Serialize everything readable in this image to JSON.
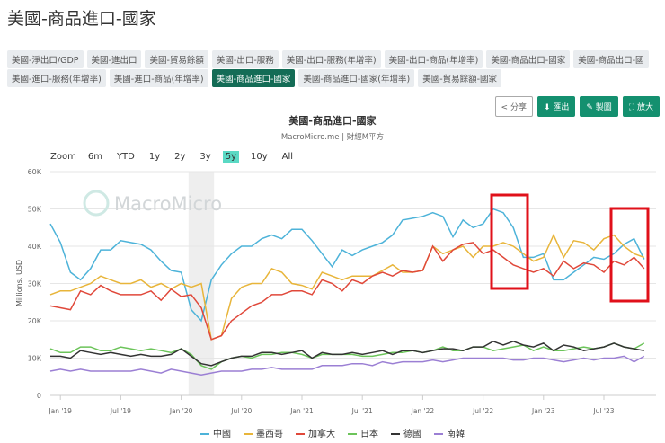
{
  "page_title": "美國-商品進口-國家",
  "tags_row1": [
    "美國-淨出口/GDP",
    "美國-進出口",
    "美國-貿易餘額",
    "美國-出口-服務",
    "美國-出口-服務(年增率)",
    "美國-出口-商品(年增率)",
    "美國-商品出口-國家",
    "美國-商品出口-國"
  ],
  "tags_row2": [
    "美國-進口-服務(年增率)",
    "美國-進口-商品(年增率)",
    "美國-商品進口-國家",
    "美國-商品進口-國家(年增率)",
    "美國-貿易餘額-國家"
  ],
  "active_tag": "美國-商品進口-國家",
  "buttons": {
    "share": "分享",
    "export": "匯出",
    "draw": "製圖",
    "enlarge": "放大"
  },
  "zoom": {
    "label": "Zoom",
    "options": [
      "6m",
      "YTD",
      "1y",
      "2y",
      "3y",
      "5y",
      "10y",
      "All"
    ],
    "selected": "5y"
  },
  "watermark": "MacroMicro",
  "chart_data": {
    "type": "line",
    "title": "美國-商品進口-國家",
    "subtitle": "MacroMicro.me | 財經M平方",
    "ylabel": "Millions, USD",
    "ylim": [
      0,
      60000
    ],
    "yticks": [
      "0",
      "10K",
      "20K",
      "30K",
      "40K",
      "50K",
      "60K"
    ],
    "start": "2018-12",
    "unit": "K",
    "xticks": [
      {
        "label": "Jan '19",
        "m": 1
      },
      {
        "label": "Jul '19",
        "m": 7
      },
      {
        "label": "Jan '20",
        "m": 13
      },
      {
        "label": "Jul '20",
        "m": 19
      },
      {
        "label": "Jan '21",
        "m": 25
      },
      {
        "label": "Jul '21",
        "m": 31
      },
      {
        "label": "Jan '22",
        "m": 37
      },
      {
        "label": "Jul '22",
        "m": 43
      },
      {
        "label": "Jan '23",
        "m": 49
      },
      {
        "label": "Jul '23",
        "m": 55
      }
    ],
    "recession_band": [
      "2020-02",
      "2020-04"
    ],
    "series": [
      {
        "name": "中國",
        "color": "#4db3d9",
        "values": [
          46,
          41,
          33,
          31,
          34,
          39,
          39,
          41.5,
          41,
          40.5,
          39,
          36,
          33.5,
          33,
          23,
          20,
          31,
          35,
          38,
          40,
          40,
          42,
          43,
          42,
          44.5,
          44.5,
          41.5,
          38,
          34.5,
          39,
          37.5,
          39,
          40,
          41,
          43,
          47,
          47.5,
          48,
          49,
          48,
          42.5,
          47,
          45,
          46,
          50,
          49,
          45,
          37,
          37,
          38,
          31,
          31,
          33,
          35,
          37,
          36.5,
          38,
          40.5,
          42,
          36.5
        ]
      },
      {
        "name": "墨西哥",
        "color": "#e8b53a",
        "values": [
          27,
          28,
          28,
          29,
          30,
          32,
          31,
          30,
          30,
          31,
          29,
          30,
          28.5,
          30,
          29,
          30,
          15,
          16,
          26,
          29,
          30,
          30,
          34,
          33,
          30,
          29.5,
          28.5,
          33,
          32,
          31,
          32,
          32,
          32,
          33.5,
          35,
          33,
          33,
          33.5,
          40,
          38,
          39,
          40,
          37,
          40,
          40,
          41,
          40,
          38,
          36,
          37,
          43,
          37,
          41.5,
          41,
          39,
          42,
          43,
          40,
          38,
          37
        ]
      },
      {
        "name": "加拿大",
        "color": "#e0483a",
        "values": [
          24,
          23.5,
          23,
          28,
          27,
          29.5,
          28,
          27,
          27,
          27,
          28,
          25.5,
          28.5,
          26.5,
          27,
          23.5,
          15,
          16,
          20,
          22,
          24,
          25,
          27,
          27,
          28,
          28,
          27,
          31,
          30,
          28,
          31,
          30,
          32,
          33,
          32,
          33.5,
          33,
          33.5,
          40,
          36,
          39,
          40.5,
          41,
          38,
          39,
          37,
          35,
          34,
          33,
          34,
          32,
          36,
          34,
          35.5,
          35,
          33,
          36,
          35,
          37,
          34
        ]
      },
      {
        "name": "日本",
        "color": "#6cc45a",
        "values": [
          12.5,
          11.5,
          11.5,
          13,
          13,
          12,
          12,
          13,
          12.5,
          12,
          12.5,
          12,
          11.5,
          12.5,
          11,
          8,
          7,
          9,
          10,
          10.5,
          10,
          11,
          11,
          11.5,
          11.5,
          11,
          10,
          11,
          11,
          11,
          11,
          10.5,
          10.5,
          11,
          11.5,
          11.5,
          12,
          11.5,
          12,
          13,
          12,
          12,
          13,
          13,
          12,
          12.5,
          13,
          13.5,
          12,
          13,
          12,
          12,
          12.5,
          13,
          12.5,
          13,
          14,
          13,
          12.5,
          14
        ]
      },
      {
        "name": "德國",
        "color": "#333333",
        "values": [
          10.5,
          10.5,
          10,
          12,
          11.5,
          11,
          11.5,
          11,
          10.5,
          11,
          10.5,
          10.5,
          11,
          12.5,
          10.5,
          8.5,
          8,
          9,
          10,
          10.5,
          10.5,
          11.5,
          11.5,
          11,
          11.5,
          12,
          10,
          11.5,
          11,
          11,
          11.5,
          11,
          11.5,
          12,
          11,
          12,
          12,
          11.5,
          12,
          12.5,
          12.5,
          12,
          13,
          13,
          14.5,
          13.5,
          14.5,
          13.5,
          13,
          14,
          12,
          13.5,
          13,
          12,
          12.5,
          13,
          14,
          13,
          12.5,
          12
        ]
      },
      {
        "name": "南韓",
        "color": "#9b7fd4",
        "values": [
          6.5,
          7,
          6.5,
          7,
          6.5,
          6.5,
          6.5,
          6.5,
          6.5,
          7,
          6.5,
          6,
          7,
          6.5,
          6,
          5.5,
          6,
          6.5,
          6.5,
          6.5,
          7,
          7,
          7.5,
          7,
          7,
          7,
          7,
          8,
          8,
          8,
          8.5,
          8.5,
          8,
          9,
          8.5,
          9,
          9,
          9,
          9.5,
          9,
          9.5,
          10,
          10,
          10,
          10,
          10,
          9.5,
          9.5,
          10,
          10,
          9.5,
          9,
          9.5,
          10,
          9.5,
          10,
          10,
          10.5,
          9,
          10.5
        ]
      }
    ]
  },
  "annotations": [
    {
      "type": "red-rectangle",
      "from": "2022-08",
      "to": "2022-11"
    },
    {
      "type": "red-rectangle",
      "from": "2023-08",
      "to": "2023-11"
    }
  ]
}
